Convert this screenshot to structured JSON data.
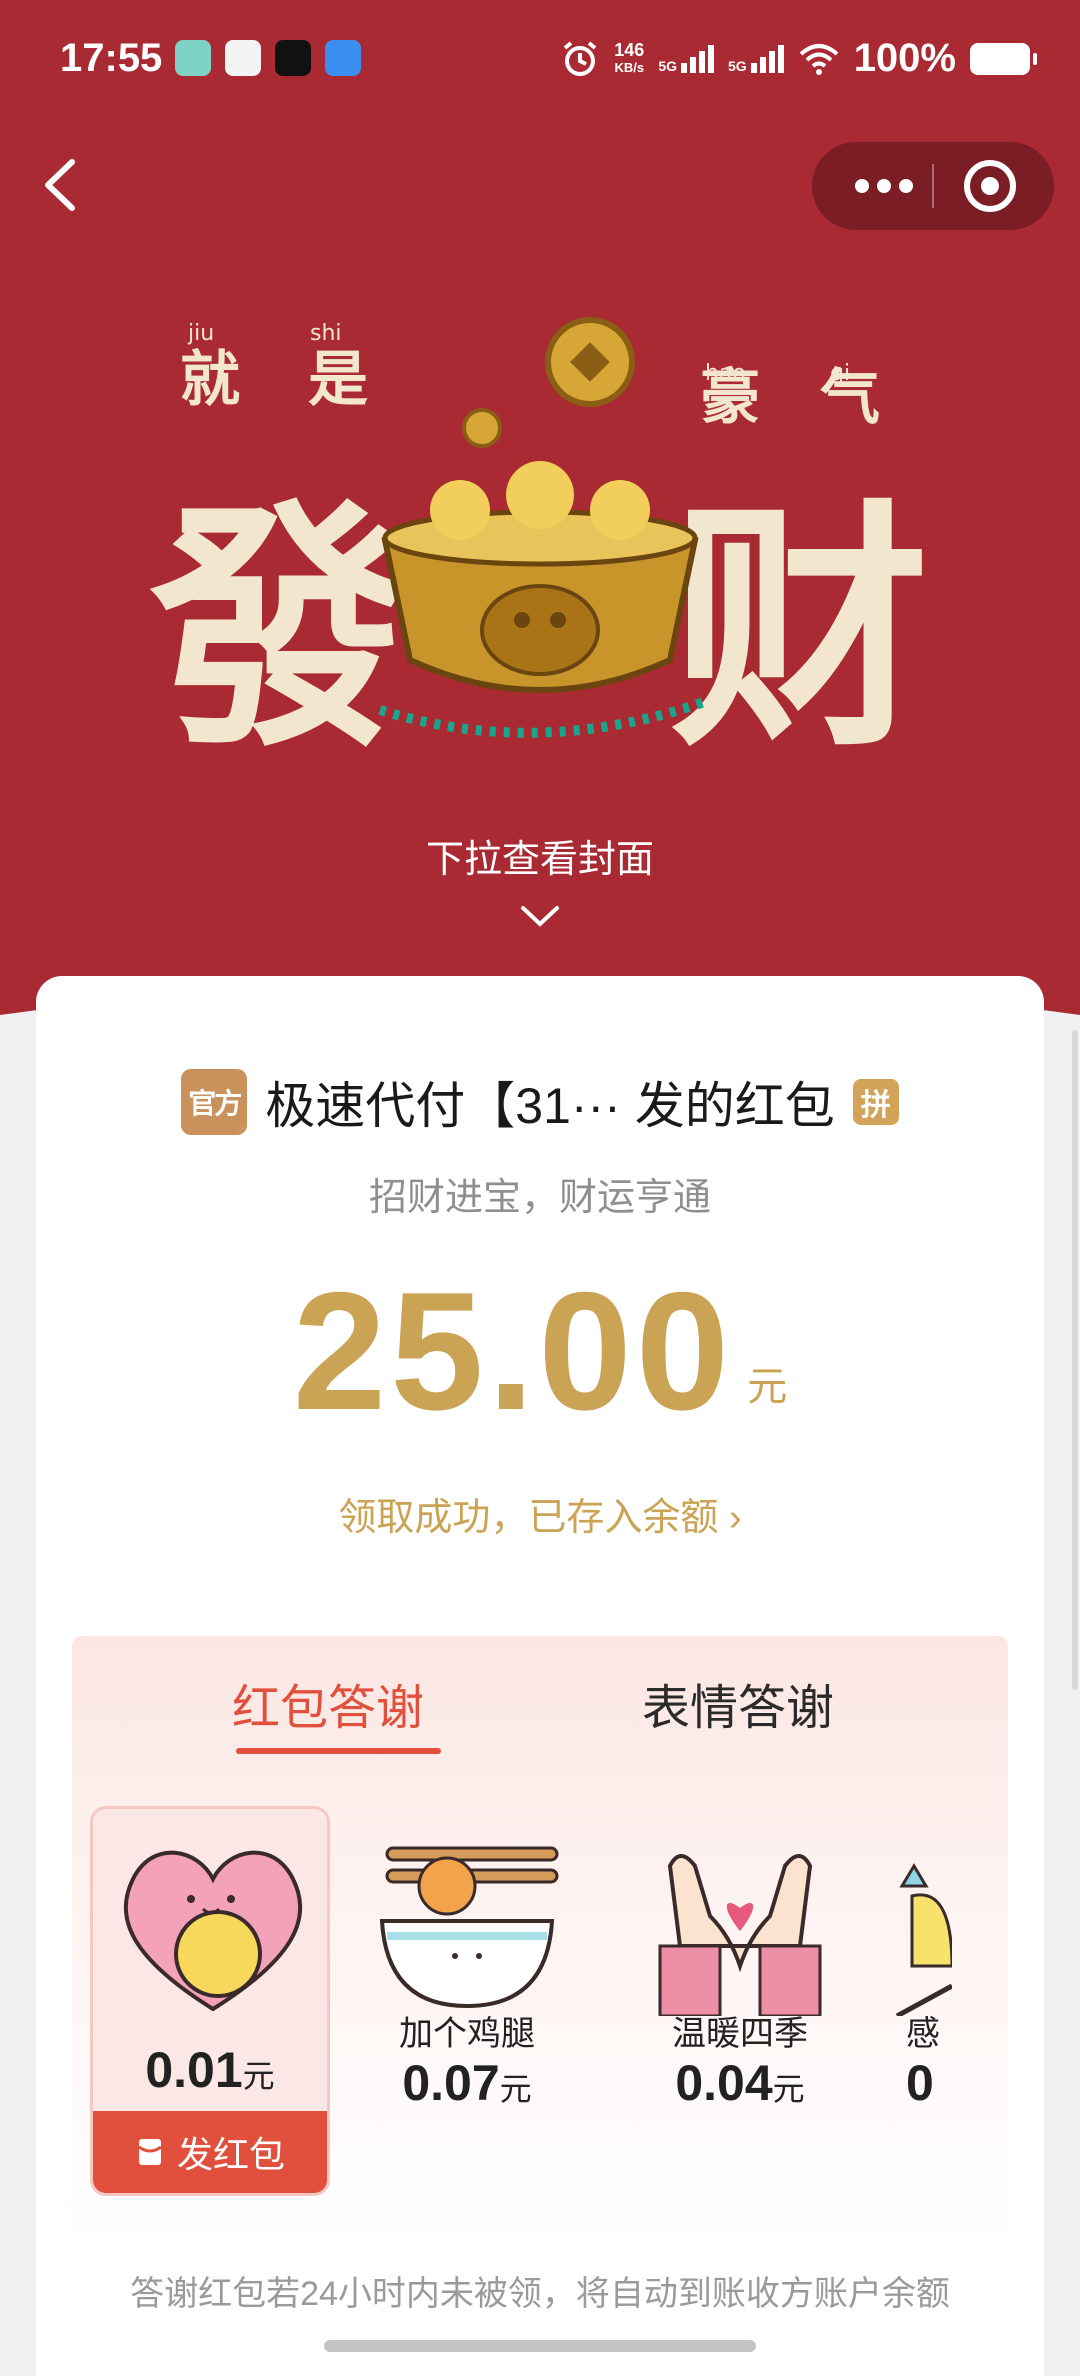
{
  "status_bar": {
    "time": "17:55",
    "net_speed_value": "146",
    "net_speed_unit": "KB/s",
    "sim1": "5G",
    "sim2": "5G",
    "battery": "100%"
  },
  "nav": {
    "back_icon": "chevron-left-icon",
    "more_icon": "more-dots-icon",
    "target_icon": "target-circle-icon"
  },
  "cover": {
    "pull_hint": "下拉查看封面",
    "art_text_main": "發財",
    "art_text_small_left": "就是",
    "art_text_small_right": "豪气",
    "pinyin": [
      "jiu",
      "shi",
      "hao",
      "qi"
    ]
  },
  "packet": {
    "official_badge": "官方",
    "sender": "极速代付【31··· 发的红包",
    "pin_tag": "拼",
    "blessing": "招财进宝，财运亨通",
    "amount": "25.00",
    "unit": "元",
    "status": "领取成功，已存入余额 ›"
  },
  "thanks": {
    "tabs": [
      "红包答谢",
      "表情答谢"
    ],
    "items": [
      {
        "name": "",
        "price": "0.01",
        "unit": "元",
        "icon": "heart-hug-icon"
      },
      {
        "name": "加个鸡腿",
        "price": "0.07",
        "unit": "元",
        "icon": "rice-bowl-drumstick-icon"
      },
      {
        "name": "温暖四季",
        "price": "0.04",
        "unit": "元",
        "icon": "heart-hands-icon"
      },
      {
        "name": "感",
        "price": "0",
        "unit": "",
        "icon": "star-cup-icon"
      }
    ],
    "send_label": "发红包",
    "footer_note": "答谢红包若24小时内未被领，将自动到账收方账户余额"
  },
  "colors": {
    "hero_red": "#a92a33",
    "gold": "#caa354",
    "accent_red": "#e0503c"
  }
}
